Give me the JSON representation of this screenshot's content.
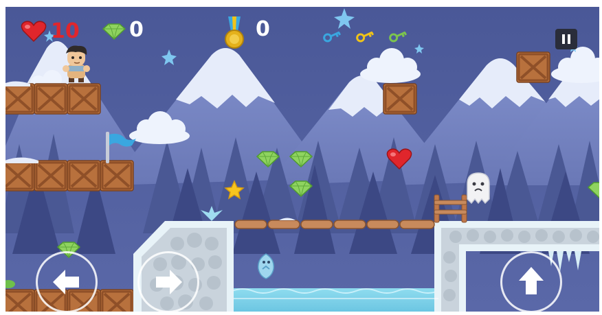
{
  "hud": {
    "lives": "10",
    "gems": "0",
    "medals": "0",
    "colors": {
      "lives_text": "#e0262c",
      "counter_text": "#ffffff",
      "heart": "#e0262c",
      "gem": "#8fd35f",
      "medal": "#e5b11b",
      "key_blue": "#3aa7e0",
      "key_yellow": "#f0c419",
      "key_green": "#7cc44e"
    },
    "keys": [
      "blue-key-icon",
      "yellow-key-icon",
      "green-key-icon"
    ],
    "pause_icon": "pause-icon"
  },
  "controls": {
    "left_icon": "arrow-left-icon",
    "right_icon": "arrow-right-icon",
    "jump_icon": "arrow-up-icon"
  },
  "scene": {
    "sky_color": "#4e5d9c",
    "mountain_color": "#7683c0",
    "snow_color": "#e6ecfa",
    "tree_color": "#3d4a86",
    "crate_color": "#b8713d",
    "water_color": "#8ad8ee",
    "ice_color": "#e8f3f8",
    "items": [
      "player-character",
      "checkpoint-flag",
      "gem-pickup",
      "star-pickup",
      "heart-pickup",
      "ghost-enemy",
      "ice-fish-enemy",
      "wooden-bridge",
      "wooden-fence",
      "icicles"
    ]
  }
}
